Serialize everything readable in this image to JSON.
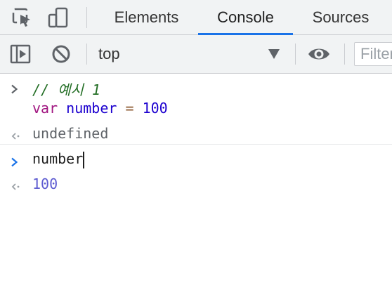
{
  "devtools": {
    "tabs": [
      {
        "label": "Elements",
        "active": false
      },
      {
        "label": "Console",
        "active": true
      },
      {
        "label": "Sources",
        "active": false
      }
    ],
    "tab_icons": [
      "inspect-element-icon",
      "device-toolbar-icon"
    ]
  },
  "toolbar": {
    "context_label": "top",
    "filter_placeholder": "Filter",
    "icons": [
      "sidebar-toggle-icon",
      "clear-console-icon",
      "chevron-down-icon",
      "eye-icon"
    ]
  },
  "console": {
    "entries": [
      {
        "type": "input",
        "lines": [
          "// 예시 1",
          "var number = 100"
        ]
      },
      {
        "type": "result",
        "text": "undefined"
      },
      {
        "type": "prompt",
        "text": "number"
      },
      {
        "type": "result",
        "text": "100"
      }
    ],
    "code": {
      "comment": "// 예시 1",
      "keyword": "var",
      "identifier": "number",
      "operator": "=",
      "number": "100"
    },
    "result_undefined": "undefined",
    "prompt_text": "number",
    "result_value": "100"
  },
  "colors": {
    "accent": "#1a73e8",
    "comment": "#236e25",
    "keyword": "#a11580",
    "number": "#1c00cf",
    "result_number": "#5e5cd1"
  }
}
